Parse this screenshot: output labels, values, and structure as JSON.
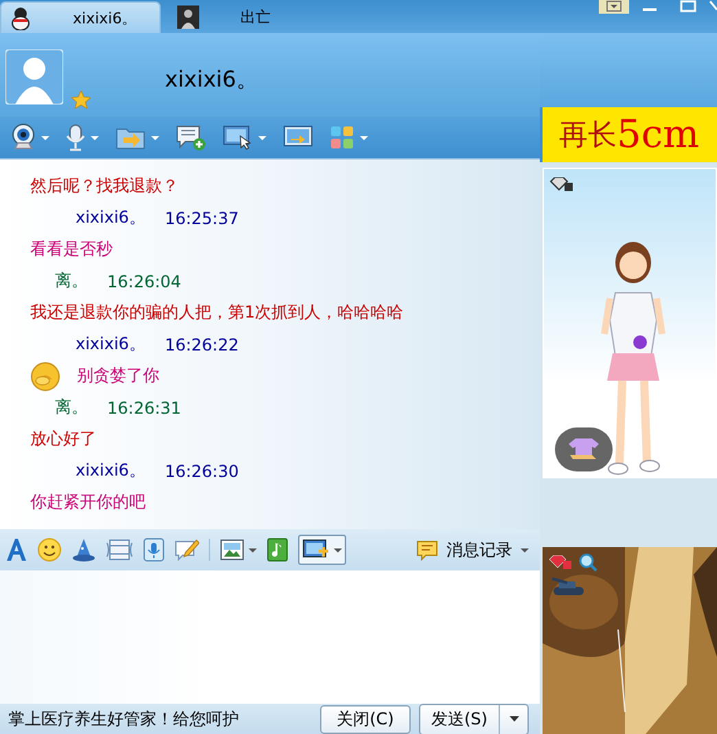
{
  "tabs": [
    {
      "label": "xixixi6。",
      "selected": true
    },
    {
      "label": "出亡",
      "selected": false
    }
  ],
  "contact": {
    "name": "xixixi6。"
  },
  "banner": {
    "text": "再长",
    "highlight": "5cm"
  },
  "messages": [
    {
      "kind": "text",
      "text": "然后呢？找我退款？",
      "color": "#cc0000"
    },
    {
      "kind": "peer_header",
      "sender": "xixixi6。",
      "time": "16:25:37",
      "color": "#000099"
    },
    {
      "kind": "text",
      "text": "看看是否秒",
      "color": "#cc0077"
    },
    {
      "kind": "own_header",
      "sender": "离。",
      "time": "16:26:04",
      "color": "#006633"
    },
    {
      "kind": "text",
      "text": "我还是退款你的骗的人把，第1次抓到人，哈哈哈哈",
      "color": "#cc0000"
    },
    {
      "kind": "peer_header",
      "sender": "xixixi6。",
      "time": "16:26:22",
      "color": "#000099"
    },
    {
      "kind": "emoji_text",
      "text": "别贪婪了你",
      "color": "#cc0077"
    },
    {
      "kind": "own_header",
      "sender": "离。",
      "time": "16:26:31",
      "color": "#006633"
    },
    {
      "kind": "text",
      "text": "放心好了",
      "color": "#cc0000"
    },
    {
      "kind": "peer_header",
      "sender": "xixixi6。",
      "time": "16:26:30",
      "color": "#000099"
    },
    {
      "kind": "text",
      "text": "你赶紧开你的吧",
      "color": "#cc0077"
    }
  ],
  "history_button": {
    "label": "消息记录"
  },
  "status": "掌上医疗养生好管家！给您呵护",
  "buttons": [
    {
      "kind": "close",
      "label": "关闭(C)"
    },
    {
      "kind": "send",
      "label": "发送(S)"
    }
  ]
}
